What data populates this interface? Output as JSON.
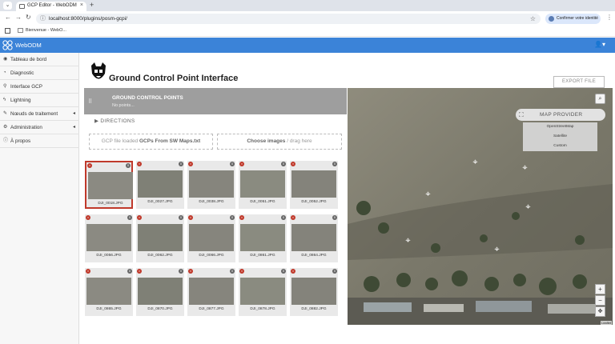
{
  "browser": {
    "tab_title": "GCP Editor - WebODM",
    "address": "localhost:8000/plugins/posm-gcpi/",
    "identity_button": "Confirmer votre identité",
    "bookmark": "Bienvenue - WebO..."
  },
  "app": {
    "brand": "WebODM",
    "accent_color": "#3b83d8"
  },
  "sidebar": {
    "items": [
      {
        "label": "Tableau de bord",
        "icon": "dashboard-icon"
      },
      {
        "label": "Diagnostic",
        "icon": "chart-icon"
      },
      {
        "label": "Interface GCP",
        "icon": "map-marker-icon"
      },
      {
        "label": "Lightning",
        "icon": "bolt-icon"
      },
      {
        "label": "Nœuds de traitement",
        "icon": "wrench-icon",
        "expandable": true
      },
      {
        "label": "Administration",
        "icon": "gears-icon",
        "expandable": true
      },
      {
        "label": "À propos",
        "icon": "info-icon"
      }
    ]
  },
  "main": {
    "title": "Ground Control Point Interface",
    "export_button": "EXPORT FILE",
    "gcp_panel": {
      "title": "GROUND CONTROL POINTS",
      "subtitle": "No points..."
    },
    "directions": "DIRECTIONS",
    "gcp_file_label": "GCP file loaded",
    "gcp_file_name": "GCPs From SW Maps.txt",
    "choose_images": "Choose images",
    "drag_here": "/ drag here",
    "images": [
      {
        "name": "DJI_0018.JPG",
        "selected": true
      },
      {
        "name": "DJI_0027.JPG"
      },
      {
        "name": "DJI_0038.JPG"
      },
      {
        "name": "DJI_0051.JPG"
      },
      {
        "name": "DJI_0052.JPG"
      },
      {
        "name": "DJI_0056.JPG"
      },
      {
        "name": "DJI_0062.JPG"
      },
      {
        "name": "DJI_0066.JPG"
      },
      {
        "name": "DJI_0861.JPG"
      },
      {
        "name": "DJI_0864.JPG"
      },
      {
        "name": "DJI_0865.JPG"
      },
      {
        "name": "DJI_0870.JPG"
      },
      {
        "name": "DJI_0877.JPG"
      },
      {
        "name": "DJI_0878.JPG"
      },
      {
        "name": "DJI_0882.JPG"
      }
    ],
    "thumb_count_badge": "0",
    "map": {
      "provider_button": "MAP PROVIDER",
      "providers": [
        "OpenStreetMap",
        "Satellite",
        "Custom"
      ],
      "zoom_in": "+",
      "zoom_out": "−",
      "attribution": "Leaflet"
    }
  }
}
